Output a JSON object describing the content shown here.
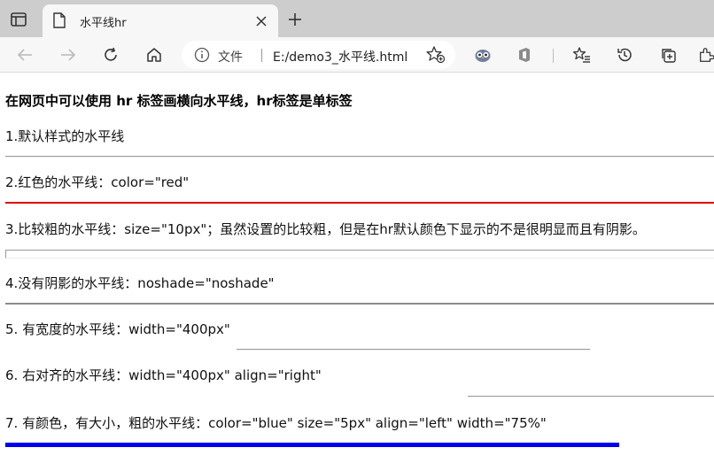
{
  "browser": {
    "tab": {
      "title": "水平线hr"
    },
    "address": {
      "label": "文件",
      "url": "E:/demo3_水平线.html"
    }
  },
  "page": {
    "heading": "在网页中可以使用 hr 标签画横向水平线，hr标签是单标签",
    "items": [
      "1.默认样式的水平线",
      "2.红色的水平线：color=\"red\"",
      "3.比较粗的水平线：size=\"10px\"；虽然设置的比较粗，但是在hr默认颜色下显示的不是很明显而且有阴影。",
      "4.没有阴影的水平线：noshade=\"noshade\"",
      "5. 有宽度的水平线：width=\"400px\"",
      "6. 右对齐的水平线：width=\"400px\" align=\"right\"",
      "7. 有颜色，有大小，粗的水平线：color=\"blue\" size=\"5px\" align=\"left\" width=\"75%\""
    ]
  },
  "colors": {
    "red_rule": "#e00000",
    "blue_rule": "#0000ee",
    "gray_rule": "#9a9a9a"
  }
}
